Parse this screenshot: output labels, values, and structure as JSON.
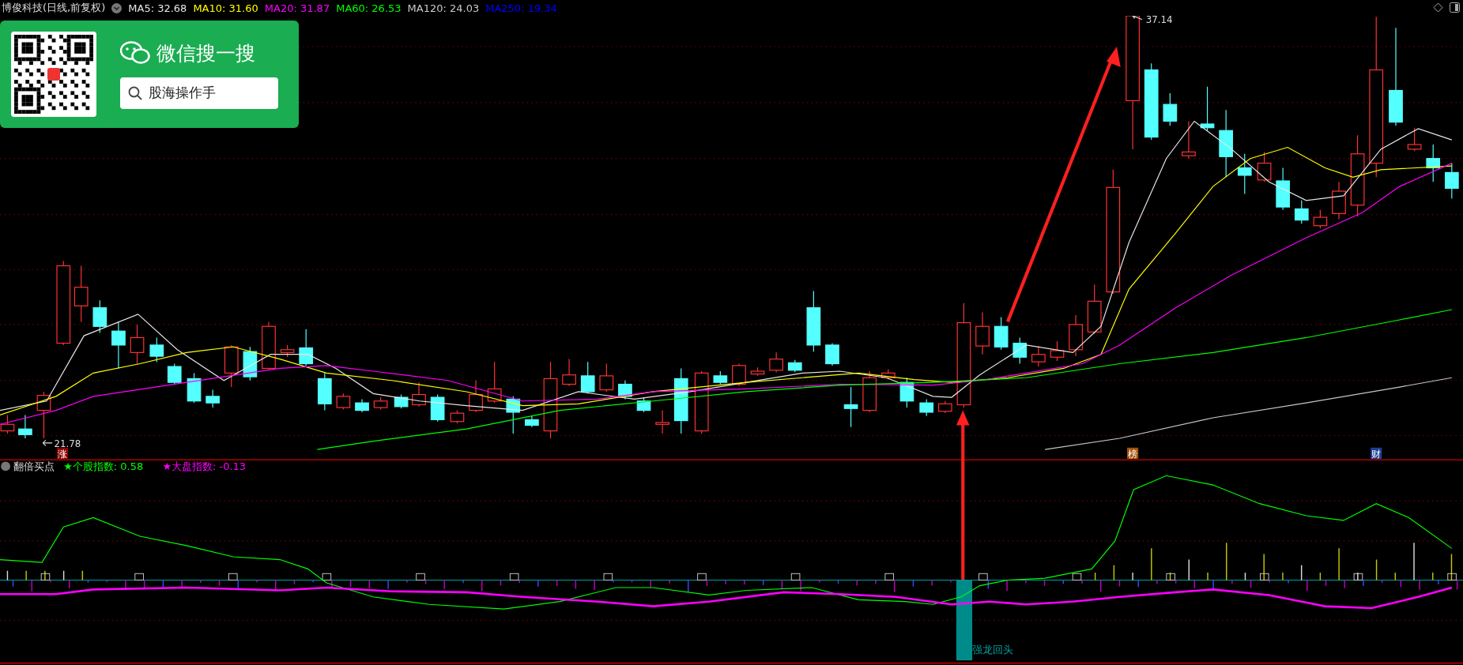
{
  "header": {
    "title": "博俊科技(日线,前复权)",
    "ma_legend": [
      {
        "label": "MA5: 32.68",
        "color": "#e6e6e6"
      },
      {
        "label": "MA10: 31.60",
        "color": "#ffff00"
      },
      {
        "label": "MA20: 31.87",
        "color": "#ff00ff"
      },
      {
        "label": "MA60: 26.53",
        "color": "#00ff00"
      },
      {
        "label": "MA120: 24.03",
        "color": "#c8c8c8"
      },
      {
        "label": "MA250: 19.34",
        "color": "#0000ff"
      }
    ]
  },
  "ad_card": {
    "title": "微信搜一搜",
    "search_text": "股海操作手"
  },
  "price_markers": {
    "high": "37.14",
    "low": "21.78"
  },
  "event_badges": [
    {
      "text": "涨",
      "color": "#8b0000"
    },
    {
      "text": "榜",
      "color": "#a0520a"
    },
    {
      "text": "财",
      "color": "#1c3f94"
    }
  ],
  "indicator": {
    "title": "翻倍买点",
    "legend": [
      {
        "label": "★个股指数: 0.58",
        "color": "#00ff00"
      },
      {
        "label": "★大盘指数: -0.13",
        "color": "#ff00ff"
      }
    ],
    "signal_label": "强龙回头"
  }
}
